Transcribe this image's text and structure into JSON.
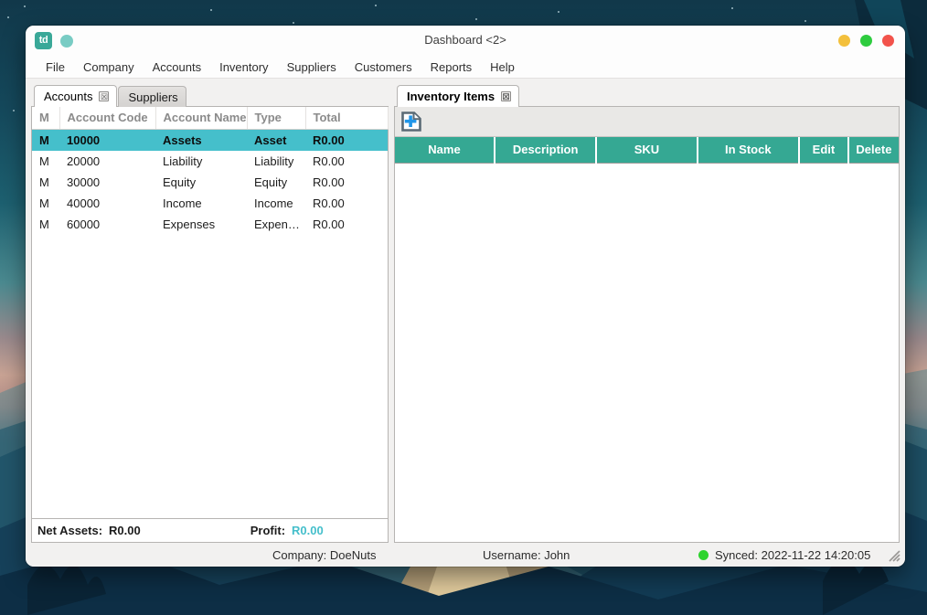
{
  "window": {
    "title": "Dashboard <2>",
    "app_icon_text": "td",
    "buttons": {
      "minimize": "minimize",
      "maximize": "maximize",
      "close": "close"
    }
  },
  "menubar": {
    "items": [
      {
        "label": "File"
      },
      {
        "label": "Company"
      },
      {
        "label": "Accounts"
      },
      {
        "label": "Inventory"
      },
      {
        "label": "Suppliers"
      },
      {
        "label": "Customers"
      },
      {
        "label": "Reports"
      },
      {
        "label": "Help"
      }
    ]
  },
  "left_pane": {
    "tabs": [
      {
        "label": "Accounts",
        "active": true,
        "closable": true
      },
      {
        "label": "Suppliers",
        "active": false,
        "closable": false
      }
    ],
    "table": {
      "columns": [
        "M",
        "Account Code",
        "Account Name",
        "Type",
        "Total"
      ],
      "rows": [
        {
          "m": "M",
          "code": "10000",
          "name": "Assets",
          "type": "Asset",
          "total": "R0.00",
          "selected": true
        },
        {
          "m": "M",
          "code": "20000",
          "name": "Liability",
          "type": "Liability",
          "total": "R0.00",
          "selected": false
        },
        {
          "m": "M",
          "code": "30000",
          "name": "Equity",
          "type": "Equity",
          "total": "R0.00",
          "selected": false
        },
        {
          "m": "M",
          "code": "40000",
          "name": "Income",
          "type": "Income",
          "total": "R0.00",
          "selected": false
        },
        {
          "m": "M",
          "code": "60000",
          "name": "Expenses",
          "type": "Expense",
          "total": "R0.00",
          "selected": false
        }
      ]
    },
    "totals": {
      "net_assets_label": "Net Assets:",
      "net_assets_value": "R0.00",
      "profit_label": "Profit:",
      "profit_value": "R0.00",
      "profit_color": "#45bfcb"
    }
  },
  "right_pane": {
    "tabs": [
      {
        "label": "Inventory Items",
        "active": true,
        "closable": true
      }
    ],
    "toolbar": {
      "add_item_label": "new-item"
    },
    "table": {
      "columns": [
        "Name",
        "Description",
        "SKU",
        "In Stock",
        "Edit",
        "Delete"
      ],
      "rows": []
    }
  },
  "statusbar": {
    "company": "Company: DoeNuts",
    "username": "Username: John",
    "sync": "Synced: 2022-11-22 14:20:05",
    "sync_status_color": "#2ed32e"
  },
  "theme": {
    "selection_teal": "#45bfcb",
    "header_teal": "#35a893",
    "accent": "#3aa898"
  }
}
